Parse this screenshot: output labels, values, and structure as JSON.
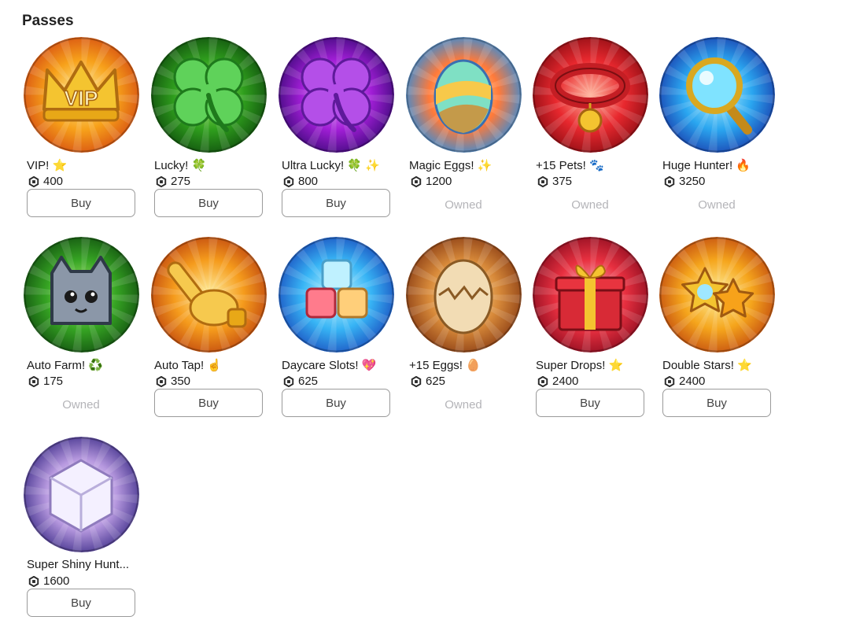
{
  "section": {
    "title": "Passes"
  },
  "labels": {
    "buy": "Buy",
    "owned": "Owned"
  },
  "passes": [
    {
      "name": "VIP! ⭐",
      "price": "400",
      "status": "buy",
      "icon": "vip-crown-icon",
      "colors": [
        "#fff3a0",
        "#f7a11a",
        "#d64e12"
      ]
    },
    {
      "name": "Lucky! 🍀",
      "price": "275",
      "status": "buy",
      "icon": "four-leaf-clover-icon",
      "colors": [
        "#a9f56a",
        "#2f9e1d",
        "#104f0e"
      ]
    },
    {
      "name": "Ultra Lucky! 🍀 ✨",
      "price": "800",
      "status": "buy",
      "icon": "purple-clover-icon",
      "colors": [
        "#f2a6ff",
        "#a11ed6",
        "#3d0a7a"
      ]
    },
    {
      "name": "Magic Eggs! ✨",
      "price": "1200",
      "status": "owned",
      "icon": "rainbow-egg-icon",
      "colors": [
        "#fff6b0",
        "#ff7a3a",
        "#2b8de0"
      ]
    },
    {
      "name": "+15 Pets! 🐾",
      "price": "375",
      "status": "owned",
      "icon": "pet-collar-icon",
      "colors": [
        "#ffb8a0",
        "#e8282e",
        "#8e0d14"
      ]
    },
    {
      "name": "Huge Hunter! 🔥",
      "price": "3250",
      "status": "owned",
      "icon": "magnifier-icon",
      "colors": [
        "#b8f6ff",
        "#2aa6f0",
        "#1a3fae"
      ]
    },
    {
      "name": "Auto Farm! ♻️",
      "price": "175",
      "status": "owned",
      "icon": "cat-pet-icon",
      "colors": [
        "#b7f57a",
        "#36a423",
        "#125110"
      ]
    },
    {
      "name": "Auto Tap! ☝️",
      "price": "350",
      "status": "buy",
      "icon": "pointing-hand-icon",
      "colors": [
        "#fff0a0",
        "#f59b1c",
        "#c0470f"
      ]
    },
    {
      "name": "Daycare Slots! 💖",
      "price": "625",
      "status": "buy",
      "icon": "blocks-icon",
      "colors": [
        "#c8fbff",
        "#37b4f5",
        "#1b4fbf"
      ]
    },
    {
      "name": "+15 Eggs! 🥚",
      "price": "625",
      "status": "owned",
      "icon": "cracked-egg-icon",
      "colors": [
        "#ffe6a8",
        "#d88a3a",
        "#8a3d14"
      ]
    },
    {
      "name": "Super Drops! ⭐",
      "price": "2400",
      "status": "buy",
      "icon": "gift-box-icon",
      "colors": [
        "#ffc0c8",
        "#e83040",
        "#8e0d20"
      ]
    },
    {
      "name": "Double Stars! ⭐",
      "price": "2400",
      "status": "buy",
      "icon": "stars-icon",
      "colors": [
        "#fff3a0",
        "#f5a51c",
        "#c24b10"
      ]
    },
    {
      "name": "Super Shiny Hunt...",
      "price": "1600",
      "status": "buy",
      "icon": "shiny-cube-icon",
      "colors": [
        "#ffffff",
        "#b89ae0",
        "#3f2f8a"
      ]
    }
  ]
}
